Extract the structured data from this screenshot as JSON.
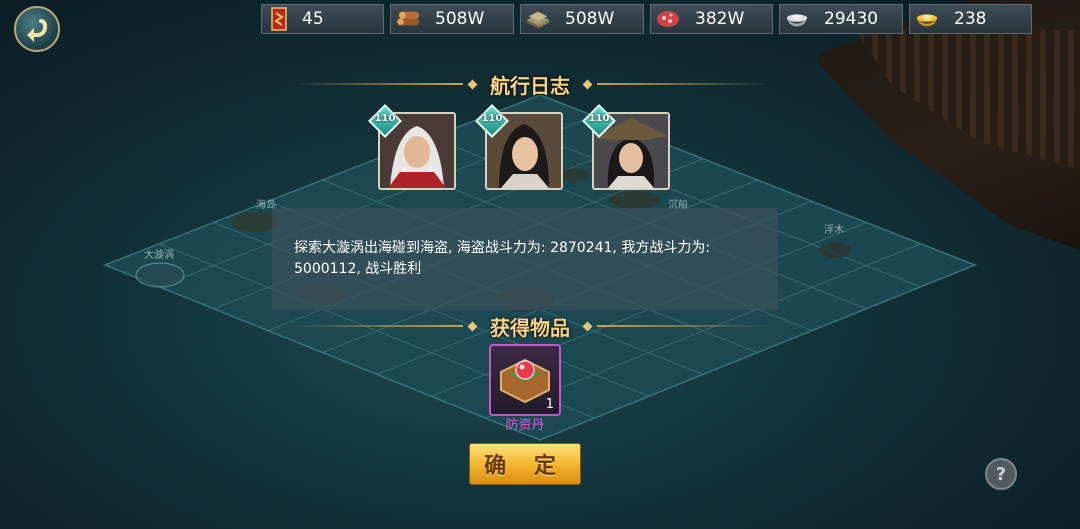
{
  "resources": [
    {
      "name": "military-order",
      "value": "45"
    },
    {
      "name": "wood",
      "value": "508W"
    },
    {
      "name": "stone",
      "value": "508W"
    },
    {
      "name": "meat",
      "value": "382W"
    },
    {
      "name": "silver",
      "value": "29430"
    },
    {
      "name": "gold",
      "value": "238"
    }
  ],
  "log": {
    "title": "航行日志",
    "message": "探索大漩涡出海碰到海盗, 海盗战斗力为: 2870241, 我方战斗力为: 5000112, 战斗胜利"
  },
  "heroes": [
    {
      "level": "110"
    },
    {
      "level": "110"
    },
    {
      "level": "110"
    }
  ],
  "rewards": {
    "title": "获得物品",
    "items": [
      {
        "name": "防资丹",
        "count": "1"
      }
    ]
  },
  "confirm_label": "确 定",
  "help_label": "?",
  "colors": {
    "title_gold": "#f7d488",
    "item_purple": "#e45ae0",
    "button_gold": "#f2b12a"
  }
}
